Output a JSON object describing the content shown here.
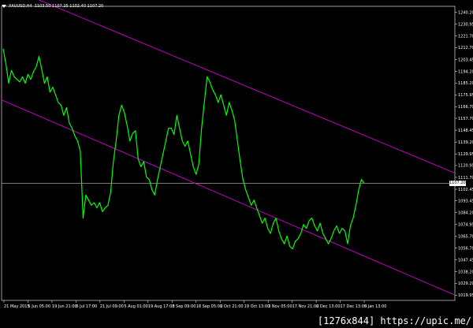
{
  "header": {
    "symbol_label": "XAUUSD,H4",
    "ohlc_text": "1103.50 1107.25 1102.40 1107.20"
  },
  "watermark": {
    "text": "[1276x844] https://upic.me/"
  },
  "chart_data": {
    "type": "line",
    "title": "XAUUSD,H4",
    "y_ticks": [
      "1240.20",
      "1230.95",
      "1221.70",
      "1212.70",
      "1203.45",
      "1194.20",
      "1185.20",
      "1175.95",
      "1166.70",
      "1157.70",
      "1148.45",
      "1139.20",
      "1129.95",
      "1120.95",
      "1111.70",
      "1102.45",
      "1093.45",
      "1084.20",
      "1074.95",
      "1065.70",
      "1056.70",
      "1047.45",
      "1038.20",
      "1029.20",
      "1019.95"
    ],
    "x_ticks": [
      "21 May 2015",
      "5 Jun 05:00",
      "19 Jun 21:00",
      "6 Jul 17:00",
      "21 Jul 09:00",
      "5 Aug 01:00",
      "19 Aug 17:00",
      "3 Sep 09:00",
      "18 Sep 05:00",
      "2 Oct 21:00",
      "19 Oct 13:00",
      "3 Nov 05:00",
      "17 Nov 21:00",
      "2 Dec 13:00",
      "17 Dec 13:00",
      "5 Jan 13:00"
    ],
    "ylim": [
      1015.9,
      1244.9
    ],
    "current_price": "1107.20",
    "series": [
      {
        "color": "#00ff00",
        "values": [
          1212,
          1200,
          1185,
          1195,
          1190,
          1188,
          1186,
          1190,
          1185,
          1192,
          1188,
          1194,
          1198,
          1206,
          1196,
          1185,
          1190,
          1178,
          1182,
          1176,
          1170,
          1168,
          1160,
          1166,
          1154,
          1150,
          1144,
          1140,
          1132,
          1080,
          1098,
          1094,
          1090,
          1092,
          1088,
          1092,
          1085,
          1088,
          1090,
          1100,
          1124,
          1140,
          1160,
          1168,
          1162,
          1152,
          1140,
          1146,
          1148,
          1126,
          1120,
          1124,
          1112,
          1110,
          1102,
          1098,
          1110,
          1120,
          1130,
          1140,
          1150,
          1150,
          1145,
          1160,
          1150,
          1140,
          1136,
          1140,
          1130,
          1120,
          1114,
          1122,
          1150,
          1170,
          1190,
          1186,
          1180,
          1176,
          1170,
          1176,
          1168,
          1160,
          1170,
          1164,
          1156,
          1140,
          1124,
          1110,
          1102,
          1096,
          1090,
          1094,
          1088,
          1082,
          1076,
          1080,
          1072,
          1068,
          1076,
          1080,
          1070,
          1064,
          1060,
          1066,
          1058,
          1056,
          1062,
          1064,
          1068,
          1075,
          1072,
          1078,
          1080,
          1074,
          1070,
          1076,
          1068,
          1064,
          1060,
          1064,
          1070,
          1074,
          1068,
          1072,
          1070,
          1060,
          1074,
          1080,
          1090,
          1102,
          1110,
          1107
        ]
      }
    ],
    "channel_lines": [
      {
        "color": "#c000c0",
        "x": [
          0,
          1
        ],
        "y": [
          1262.0,
          1115.0
        ]
      },
      {
        "color": "#c000c0",
        "x": [
          0,
          1
        ],
        "y": [
          1172.0,
          1020.0
        ]
      }
    ],
    "horizontal_lines": [
      {
        "color": "#c0c0c0",
        "y": 1107.2
      }
    ]
  }
}
